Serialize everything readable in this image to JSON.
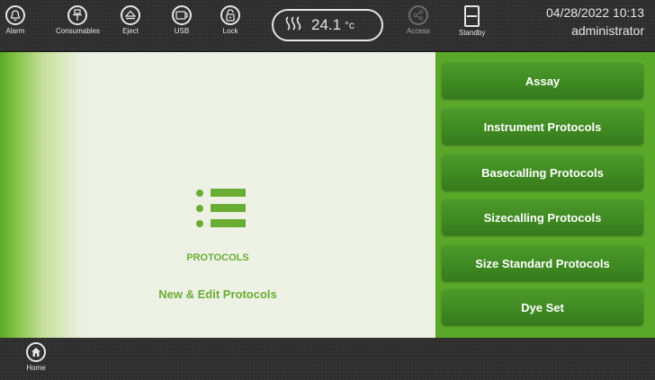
{
  "toolbar": {
    "alarm_label": "Alarm",
    "consumables_label": "Consumables",
    "eject_label": "Eject",
    "usb_label": "USB",
    "lock_label": "Lock",
    "temperature_value": "24.1",
    "temperature_unit": "°c",
    "access_label": "Access",
    "standby_label": "Standby",
    "datetime": "04/28/2022 10:13",
    "user": "administrator"
  },
  "main": {
    "section_title": "PROTOCOLS",
    "section_subtitle": "New & Edit Protocols",
    "icon": "list-icon"
  },
  "menu": {
    "items": [
      {
        "label": "Assay"
      },
      {
        "label": "Instrument Protocols"
      },
      {
        "label": "Basecalling Protocols"
      },
      {
        "label": "Sizecalling Protocols"
      },
      {
        "label": "Size Standard Protocols"
      },
      {
        "label": "Dye Set"
      }
    ]
  },
  "bottombar": {
    "home_label": "Home"
  },
  "colors": {
    "accent_green": "#6aad35",
    "button_green": "#3f8a22",
    "panel_green": "#5aa82a",
    "toolbar_dark": "#2e2e2e"
  }
}
